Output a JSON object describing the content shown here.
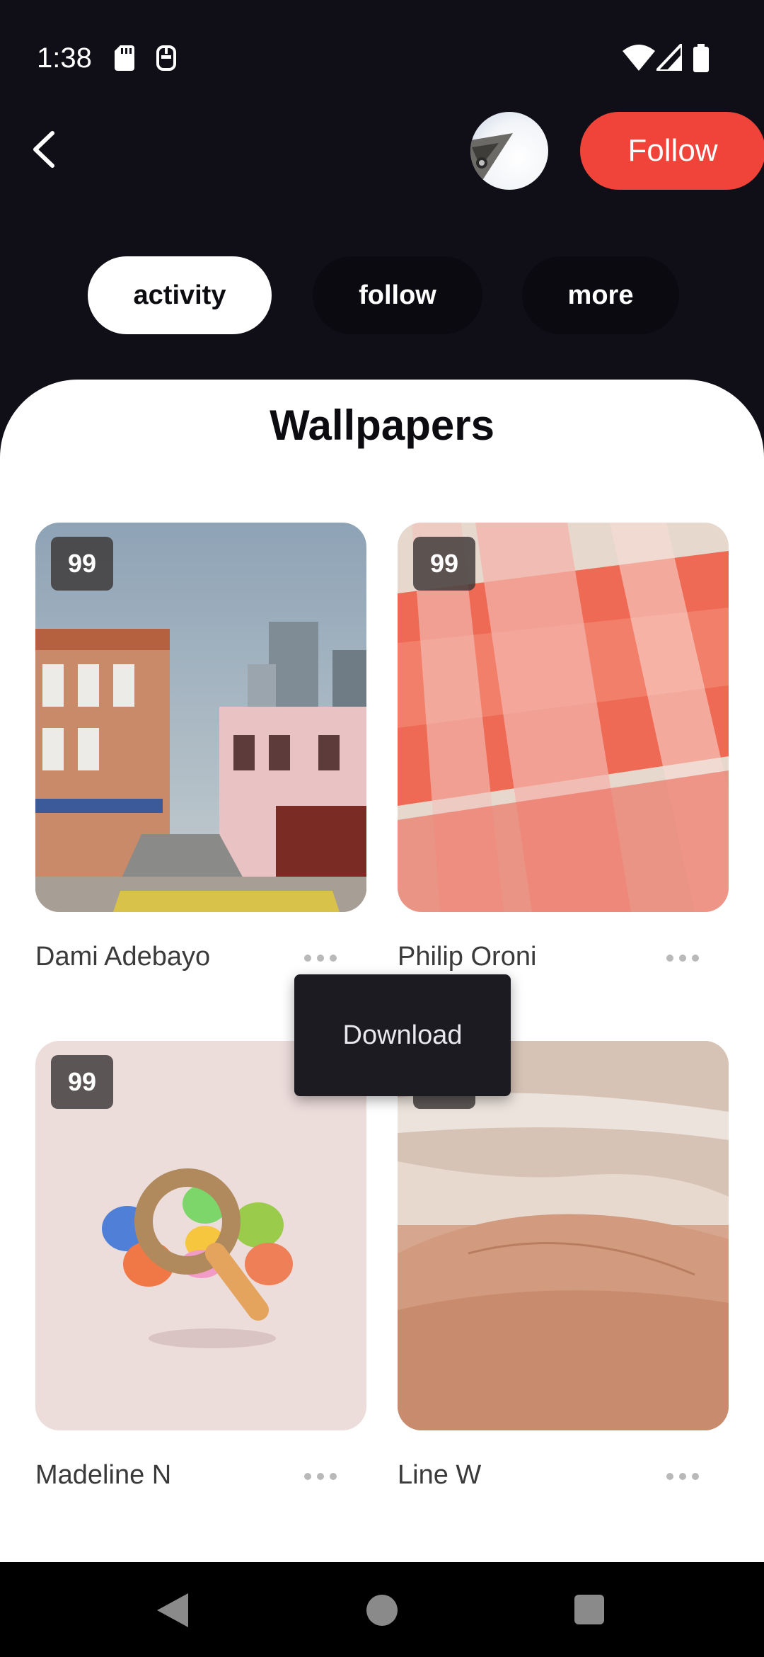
{
  "status_bar": {
    "time": "1:38"
  },
  "header": {
    "follow_label": "Follow"
  },
  "tabs": [
    {
      "label": "activity",
      "active": true
    },
    {
      "label": "follow",
      "active": false
    },
    {
      "label": "more",
      "active": false
    }
  ],
  "section_title": "Wallpapers",
  "wallpapers": [
    {
      "count": "99",
      "author": "Dami Adebayo",
      "image": "city-street-photo"
    },
    {
      "count": "99",
      "author": "Philip Oroni",
      "image": "abstract-red-glass"
    },
    {
      "count": "99",
      "author": "Madeline N",
      "image": "3d-magnifier-render"
    },
    {
      "count": "99",
      "author": "Line W",
      "image": "desert-dunes-photo"
    }
  ],
  "popup_menu": {
    "items": [
      "Download"
    ]
  },
  "colors": {
    "accent": "#f0443a",
    "background": "#100f17",
    "sheet": "#ffffff"
  }
}
